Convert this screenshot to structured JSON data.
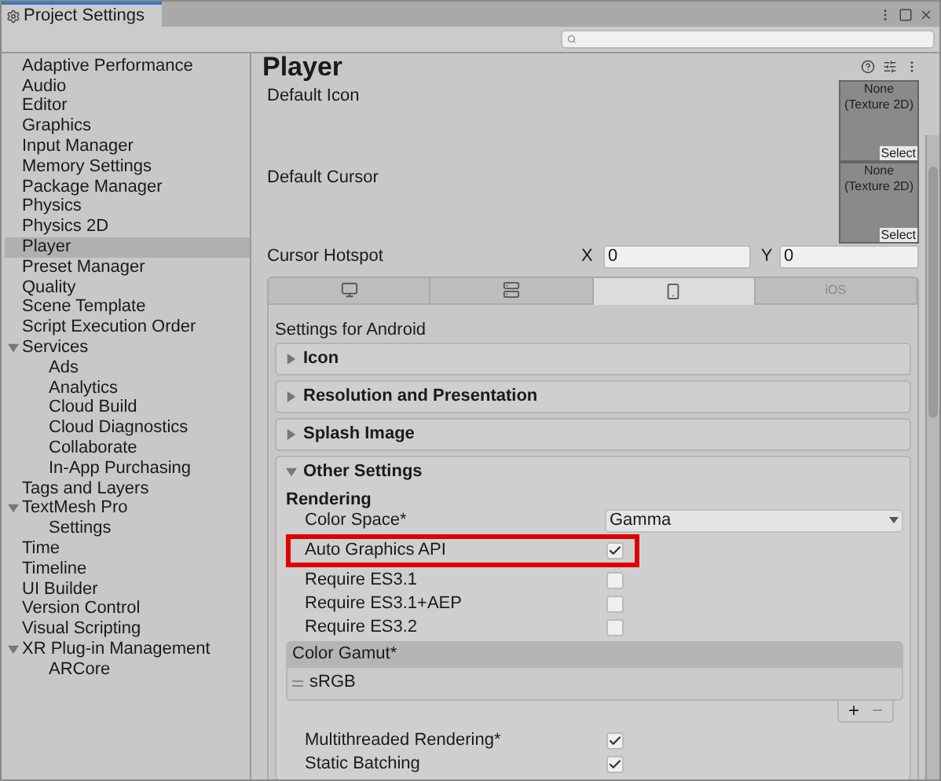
{
  "window": {
    "title": "Project Settings"
  },
  "sidebar": {
    "items": [
      {
        "label": "Adaptive Performance",
        "selected": false
      },
      {
        "label": "Audio",
        "selected": false
      },
      {
        "label": "Editor",
        "selected": false
      },
      {
        "label": "Graphics",
        "selected": false
      },
      {
        "label": "Input Manager",
        "selected": false
      },
      {
        "label": "Memory Settings",
        "selected": false
      },
      {
        "label": "Package Manager",
        "selected": false
      },
      {
        "label": "Physics",
        "selected": false
      },
      {
        "label": "Physics 2D",
        "selected": false
      },
      {
        "label": "Player",
        "selected": true
      },
      {
        "label": "Preset Manager",
        "selected": false
      },
      {
        "label": "Quality",
        "selected": false
      },
      {
        "label": "Scene Template",
        "selected": false
      },
      {
        "label": "Script Execution Order",
        "selected": false
      },
      {
        "label": "Services",
        "selected": false,
        "expanded": true,
        "children": [
          {
            "label": "Ads",
            "selected": false
          },
          {
            "label": "Analytics",
            "selected": false
          },
          {
            "label": "Cloud Build",
            "selected": false
          },
          {
            "label": "Cloud Diagnostics",
            "selected": false
          },
          {
            "label": "Collaborate",
            "selected": false
          },
          {
            "label": "In-App Purchasing",
            "selected": false
          }
        ]
      },
      {
        "label": "Tags and Layers",
        "selected": false
      },
      {
        "label": "TextMesh Pro",
        "selected": false,
        "expanded": true,
        "children": [
          {
            "label": "Settings",
            "selected": false
          }
        ]
      },
      {
        "label": "Time",
        "selected": false
      },
      {
        "label": "Timeline",
        "selected": false
      },
      {
        "label": "UI Builder",
        "selected": false
      },
      {
        "label": "Version Control",
        "selected": false
      },
      {
        "label": "Visual Scripting",
        "selected": false
      },
      {
        "label": "XR Plug-in Management",
        "selected": false,
        "expanded": true,
        "children": [
          {
            "label": "ARCore",
            "selected": false
          }
        ]
      }
    ]
  },
  "inspector": {
    "title": "Player",
    "texture_fields": [
      {
        "label": "Default Icon",
        "value": "None (Texture 2D)",
        "button": "Select"
      },
      {
        "label": "Default Cursor",
        "value": "None (Texture 2D)",
        "button": "Select"
      }
    ],
    "hotspot": {
      "label": "Cursor Hotspot",
      "x_label": "X",
      "x_value": "0",
      "y_label": "Y",
      "y_value": "0"
    },
    "platform_tabs": [
      {
        "kind": "desktop",
        "selected": false
      },
      {
        "kind": "server",
        "selected": false
      },
      {
        "kind": "android",
        "selected": true
      },
      {
        "kind": "text",
        "label": "iOS",
        "selected": false
      }
    ],
    "platform_heading": "Settings for Android",
    "foldouts": [
      {
        "label": "Icon",
        "expanded": false
      },
      {
        "label": "Resolution and Presentation",
        "expanded": false
      },
      {
        "label": "Splash Image",
        "expanded": false
      },
      {
        "label": "Other Settings",
        "expanded": true
      }
    ],
    "other_settings": {
      "section": "Rendering",
      "rows": [
        {
          "kind": "dropdown",
          "label": "Color Space*",
          "value": "Gamma"
        },
        {
          "kind": "checkbox",
          "label": "Auto Graphics API",
          "checked": true,
          "highlighted": true
        },
        {
          "kind": "checkbox",
          "label": "Require ES3.1",
          "checked": false,
          "highlighted": false
        },
        {
          "kind": "checkbox",
          "label": "Require ES3.1+AEP",
          "checked": false,
          "highlighted": false
        },
        {
          "kind": "checkbox",
          "label": "Require ES3.2",
          "checked": false,
          "highlighted": false
        }
      ],
      "color_gamut": {
        "header": "Color Gamut*",
        "items": [
          "sRGB"
        ],
        "add": "+",
        "remove": "−"
      },
      "after_rows": [
        {
          "kind": "checkbox",
          "label": "Multithreaded Rendering*",
          "checked": true,
          "highlighted": false
        },
        {
          "kind": "checkbox",
          "label": "Static Batching",
          "checked": true,
          "highlighted": false
        }
      ]
    }
  }
}
